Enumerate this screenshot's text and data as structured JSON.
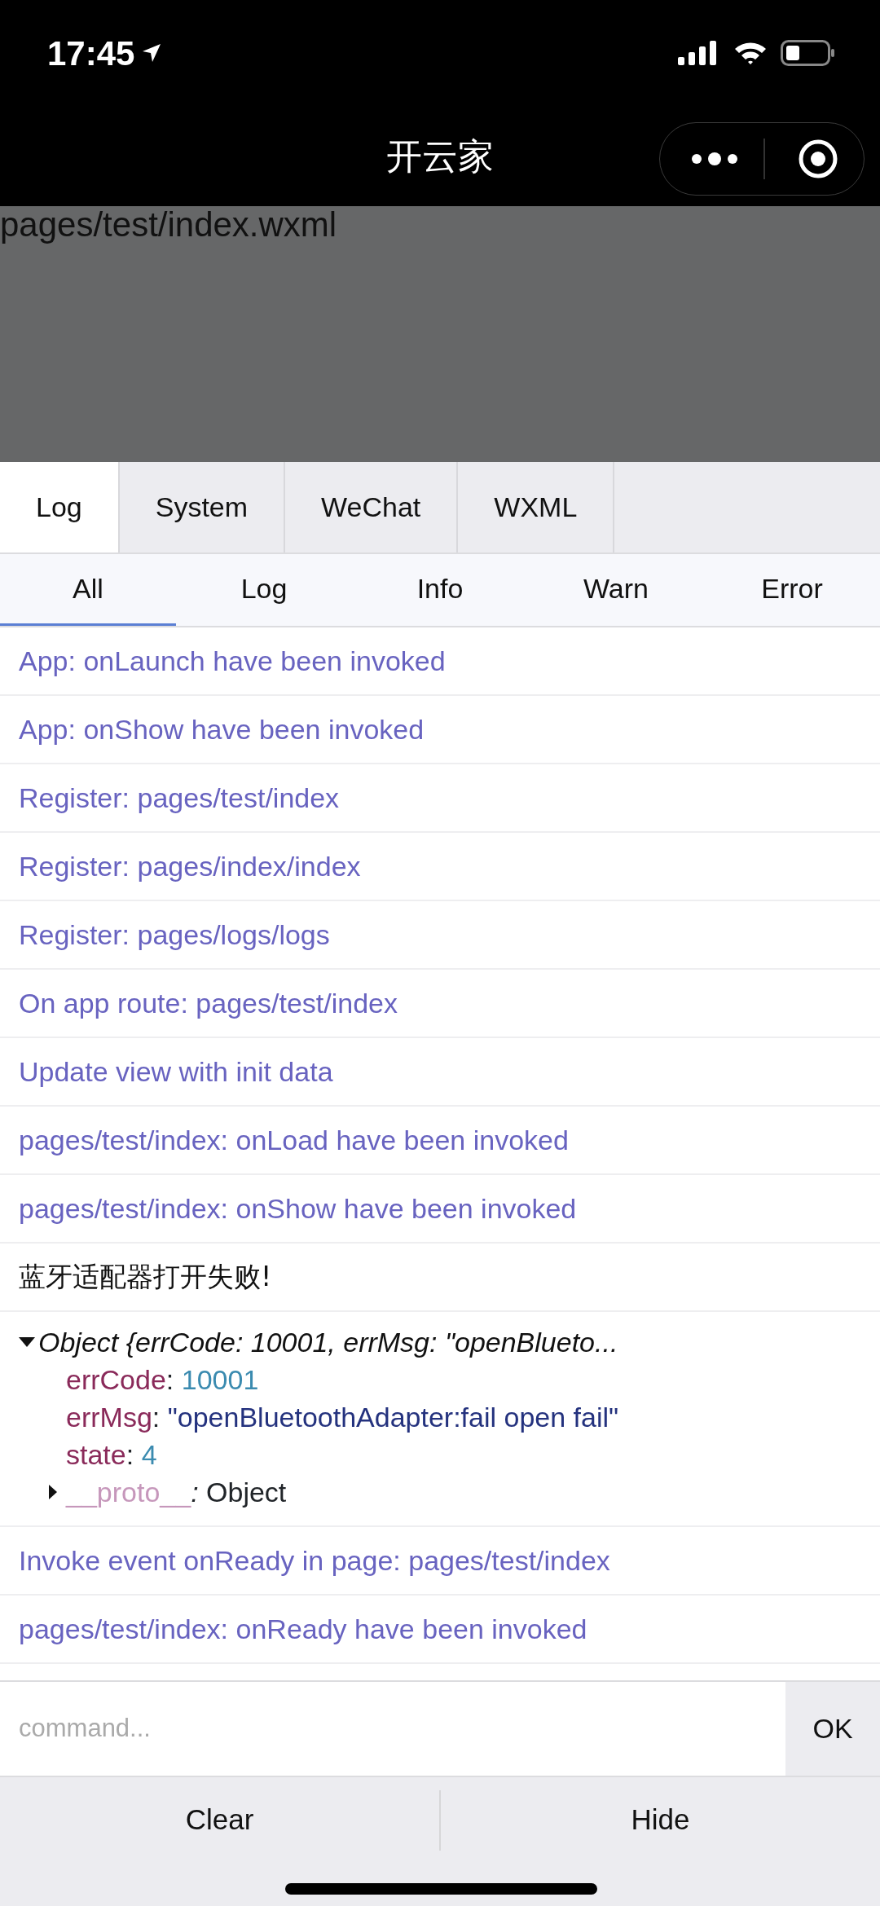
{
  "status_bar": {
    "time": "17:45"
  },
  "nav": {
    "title": "开云家"
  },
  "page": {
    "text": "pages/test/index.wxml"
  },
  "tabs": [
    {
      "label": "Log",
      "selected": true
    },
    {
      "label": "System",
      "selected": false
    },
    {
      "label": "WeChat",
      "selected": false
    },
    {
      "label": "WXML",
      "selected": false
    }
  ],
  "filters": [
    {
      "label": "All",
      "selected": true
    },
    {
      "label": "Log",
      "selected": false
    },
    {
      "label": "Info",
      "selected": false
    },
    {
      "label": "Warn",
      "selected": false
    },
    {
      "label": "Error",
      "selected": false
    }
  ],
  "logs": [
    {
      "kind": "system",
      "text": "App: onLaunch have been invoked"
    },
    {
      "kind": "system",
      "text": "App: onShow have been invoked"
    },
    {
      "kind": "system",
      "text": "Register: pages/test/index"
    },
    {
      "kind": "system",
      "text": "Register: pages/index/index"
    },
    {
      "kind": "system",
      "text": "Register: pages/logs/logs"
    },
    {
      "kind": "system",
      "text": "On app route: pages/test/index"
    },
    {
      "kind": "system",
      "text": "Update view with init data"
    },
    {
      "kind": "system",
      "text": "pages/test/index: onLoad have been invoked"
    },
    {
      "kind": "system",
      "text": "pages/test/index: onShow have been invoked"
    },
    {
      "kind": "log",
      "text": "蓝牙适配器打开失败!"
    },
    {
      "kind": "object",
      "summary": "Object {errCode: 10001, errMsg: \"openBlueto...",
      "expanded": true,
      "properties": [
        {
          "key": "errCode",
          "separator": ":",
          "value": "10001",
          "kind": "number"
        },
        {
          "key": "errMsg",
          "separator": ":",
          "value": "\"openBluetoothAdapter:fail open fail\"",
          "kind": "string"
        },
        {
          "key": "state",
          "separator": ":",
          "value": "4",
          "kind": "number"
        }
      ],
      "proto": {
        "key": "__proto__",
        "separator": ":",
        "value": "Object",
        "expanded": false
      }
    },
    {
      "kind": "system",
      "text": "Invoke event onReady in page: pages/test/index"
    },
    {
      "kind": "system",
      "text": "pages/test/index: onReady have been invoked"
    }
  ],
  "command": {
    "placeholder": "command...",
    "button": "OK"
  },
  "footer": [
    "Clear",
    "Hide"
  ]
}
